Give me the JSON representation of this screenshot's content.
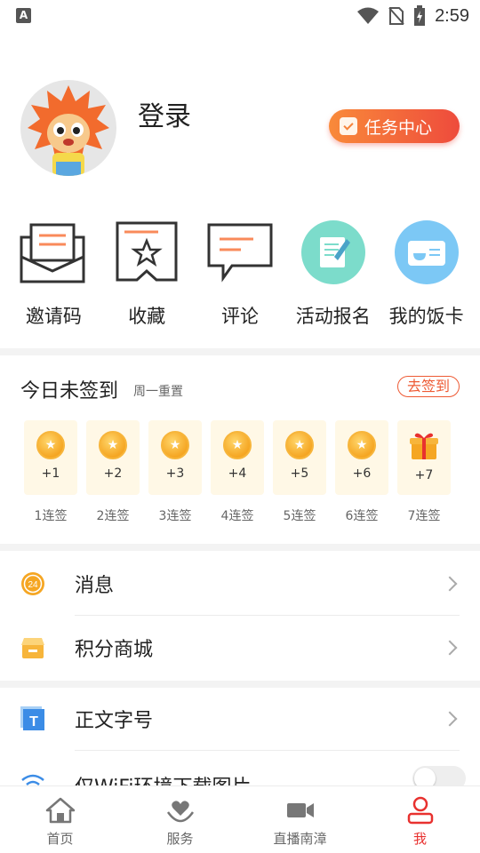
{
  "status_bar": {
    "time": "2:59",
    "left_icon": "A"
  },
  "profile": {
    "login_label": "登录",
    "task_center_label": "任务中心"
  },
  "quick_actions": [
    {
      "label": "邀请码",
      "icon": "envelope-icon"
    },
    {
      "label": "收藏",
      "icon": "star-bookmark-icon"
    },
    {
      "label": "评论",
      "icon": "comment-icon"
    },
    {
      "label": "活动报名",
      "icon": "signup-form-icon"
    },
    {
      "label": "我的饭卡",
      "icon": "meal-card-icon"
    }
  ],
  "signin": {
    "title": "今日未签到",
    "subtitle": "周一重置",
    "button_label": "去签到",
    "days": [
      {
        "points": "+1",
        "label": "1连签"
      },
      {
        "points": "+2",
        "label": "2连签"
      },
      {
        "points": "+3",
        "label": "3连签"
      },
      {
        "points": "+4",
        "label": "4连签"
      },
      {
        "points": "+5",
        "label": "5连签"
      },
      {
        "points": "+6",
        "label": "6连签"
      },
      {
        "points": "+7",
        "label": "7连签"
      }
    ]
  },
  "menu": [
    {
      "label": "消息",
      "icon": "message-badge-icon",
      "badge": "24"
    },
    {
      "label": "积分商城",
      "icon": "shop-icon"
    },
    {
      "label": "正文字号",
      "icon": "font-size-icon",
      "icon_text": "T"
    },
    {
      "label": "仅WiFi环境下载图片",
      "icon": "wifi-icon"
    }
  ],
  "tabs": [
    {
      "label": "首页",
      "icon": "home-icon"
    },
    {
      "label": "服务",
      "icon": "heart-hands-icon"
    },
    {
      "label": "直播南漳",
      "icon": "video-camera-icon"
    },
    {
      "label": "我",
      "icon": "user-icon"
    }
  ],
  "colors": {
    "accent": "#e8312f",
    "orange": "#f98a3a",
    "coin": "#f5a623",
    "teal": "#7cdccb",
    "sky": "#7cc8f5"
  }
}
